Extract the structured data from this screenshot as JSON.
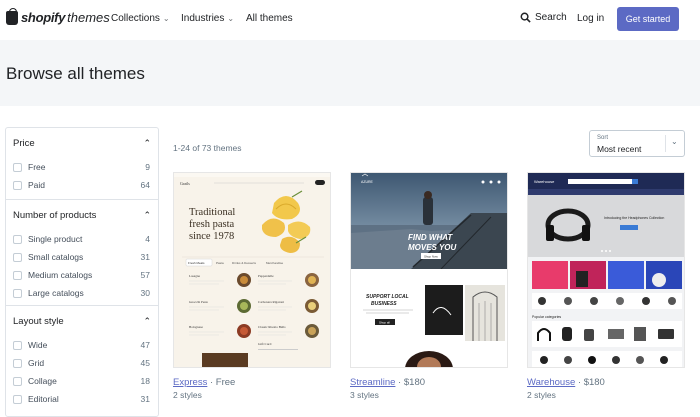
{
  "header": {
    "logo_bold": "shopify",
    "logo_light": "themes",
    "nav": [
      {
        "label": "Collections",
        "chevron": true
      },
      {
        "label": "Industries",
        "chevron": true
      },
      {
        "label": "All themes",
        "chevron": false
      }
    ],
    "search_label": "Search",
    "login_label": "Log in",
    "cta_label": "Get started",
    "cta_color": "#5c6ac4"
  },
  "hero": {
    "title": "Browse all themes"
  },
  "filters": [
    {
      "title": "Price",
      "options": [
        {
          "label": "Free",
          "count": "9"
        },
        {
          "label": "Paid",
          "count": "64"
        }
      ]
    },
    {
      "title": "Number of products",
      "options": [
        {
          "label": "Single product",
          "count": "4"
        },
        {
          "label": "Small catalogs",
          "count": "31"
        },
        {
          "label": "Medium catalogs",
          "count": "57"
        },
        {
          "label": "Large catalogs",
          "count": "30"
        }
      ]
    },
    {
      "title": "Layout style",
      "options": [
        {
          "label": "Wide",
          "count": "47"
        },
        {
          "label": "Grid",
          "count": "45"
        },
        {
          "label": "Collage",
          "count": "18"
        },
        {
          "label": "Editorial",
          "count": "31"
        }
      ]
    }
  ],
  "results": {
    "count_text": "1-24 of 73 themes",
    "sort_label": "Sort",
    "sort_value": "Most recent"
  },
  "themes": [
    {
      "name": "Express",
      "price": "Free",
      "styles": "2 styles",
      "preview": {
        "brand": "Grails",
        "headline": [
          "Traditional",
          "fresh pasta",
          "since 1978"
        ],
        "tabs": [
          "Fresh Meals",
          "Pasta",
          "Drinks & Desserts",
          "Merchandise"
        ],
        "items": [
          "Lasagna",
          "Pappardelle",
          "Gnocchi Pesto",
          "Carbonara Rigatoni",
          "Bolognese",
          "Classic Risotto Balls"
        ],
        "footer": "Gift Card"
      }
    },
    {
      "name": "Streamline",
      "price": "$180",
      "styles": "3 styles",
      "preview": {
        "brand": "AZURE",
        "headline": [
          "FIND WHAT",
          "MOVES YOU"
        ],
        "button": "Shop Now",
        "sub": [
          "SUPPORT LOCAL",
          "BUSINESS"
        ],
        "sub_button": "Shop all"
      }
    },
    {
      "name": "Warehouse",
      "price": "$180",
      "styles": "2 styles",
      "preview": {
        "brand": "Warehouse",
        "banner": "Introducing the Headphones Collection",
        "section": "Popular categories"
      }
    }
  ]
}
